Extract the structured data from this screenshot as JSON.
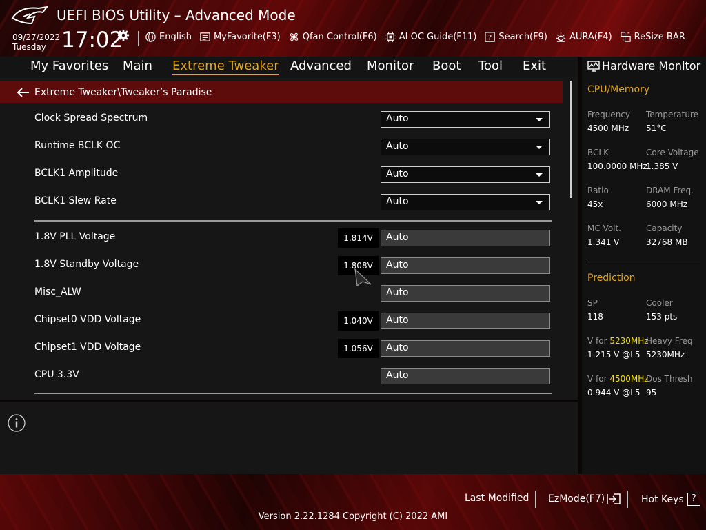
{
  "header": {
    "title": "UEFI BIOS Utility – Advanced Mode",
    "date": "09/27/2022",
    "day": "Tuesday",
    "time": "17:02",
    "toolbar": [
      {
        "label": "English",
        "icon": "globe-icon"
      },
      {
        "label": "MyFavorite(F3)",
        "icon": "favorite-list-icon"
      },
      {
        "label": "Qfan Control(F6)",
        "icon": "fan-icon"
      },
      {
        "label": "AI OC Guide(F11)",
        "icon": "chip-icon"
      },
      {
        "label": "Search(F9)",
        "icon": "search-question-icon"
      },
      {
        "label": "AURA(F4)",
        "icon": "aura-light-icon"
      },
      {
        "label": "ReSize BAR",
        "icon": "resize-bar-icon"
      }
    ]
  },
  "nav": {
    "tabs": [
      "My Favorites",
      "Main",
      "Extreme Tweaker",
      "Advanced",
      "Monitor",
      "Boot",
      "Tool",
      "Exit"
    ],
    "active": "Extreme Tweaker"
  },
  "breadcrumb": "Extreme Tweaker\\Tweaker’s Paradise",
  "settings": [
    {
      "label": "Clock Spread Spectrum",
      "value": "Auto",
      "type": "dropdown"
    },
    {
      "label": "Runtime BCLK OC",
      "value": "Auto",
      "type": "dropdown"
    },
    {
      "label": "BCLK1 Amplitude",
      "value": "Auto",
      "type": "dropdown"
    },
    {
      "label": "BCLK1 Slew Rate",
      "value": "Auto",
      "type": "dropdown"
    },
    {
      "label": "1.8V PLL Voltage",
      "value": "Auto",
      "reading": "1.814V",
      "type": "field"
    },
    {
      "label": "1.8V Standby Voltage",
      "value": "Auto",
      "reading": "1.808V",
      "type": "field"
    },
    {
      "label": "Misc_ALW",
      "value": "Auto",
      "type": "field"
    },
    {
      "label": "Chipset0 VDD Voltage",
      "value": "Auto",
      "reading": "1.040V",
      "type": "field"
    },
    {
      "label": "Chipset1 VDD Voltage",
      "value": "Auto",
      "reading": "1.056V",
      "type": "field"
    },
    {
      "label": "CPU 3.3V",
      "value": "Auto",
      "type": "field"
    }
  ],
  "hardware_monitor": {
    "title": "Hardware Monitor",
    "cpu_memory_title": "CPU/Memory",
    "cpu_memory": [
      {
        "label": "Frequency",
        "value": "4500 MHz"
      },
      {
        "label": "Temperature",
        "value": "51°C"
      },
      {
        "label": "BCLK",
        "value": "100.0000 MHz"
      },
      {
        "label": "Core Voltage",
        "value": "1.385 V"
      },
      {
        "label": "Ratio",
        "value": "45x"
      },
      {
        "label": "DRAM Freq.",
        "value": "6000 MHz"
      },
      {
        "label": "MC Volt.",
        "value": "1.341 V"
      },
      {
        "label": "Capacity",
        "value": "32768 MB"
      }
    ],
    "prediction_title": "Prediction",
    "prediction": {
      "sp_label": "SP",
      "sp_value": "118",
      "cooler_label": "Cooler",
      "cooler_value": "153 pts",
      "v1_label": "V for",
      "v1_freq": "5230MHz",
      "v1_value": "1.215 V @L5",
      "heavy_label": "Heavy Freq",
      "heavy_value": "5230MHz",
      "v2_label": "V for",
      "v2_freq": "4500MHz",
      "v2_value": "0.944 V @L5",
      "dos_label": "Dos Thresh",
      "dos_value": "95"
    }
  },
  "footer": {
    "last_modified": "Last Modified",
    "ezmode": "EzMode(F7)",
    "hotkeys": "Hot Keys",
    "hotkeys_key": "?",
    "version": "Version 2.22.1284 Copyright (C) 2022 AMI"
  },
  "colors": {
    "accent": "#e3a721",
    "highlight": "#f5e000",
    "breadcrumb_bg": "#5e0b0b"
  }
}
